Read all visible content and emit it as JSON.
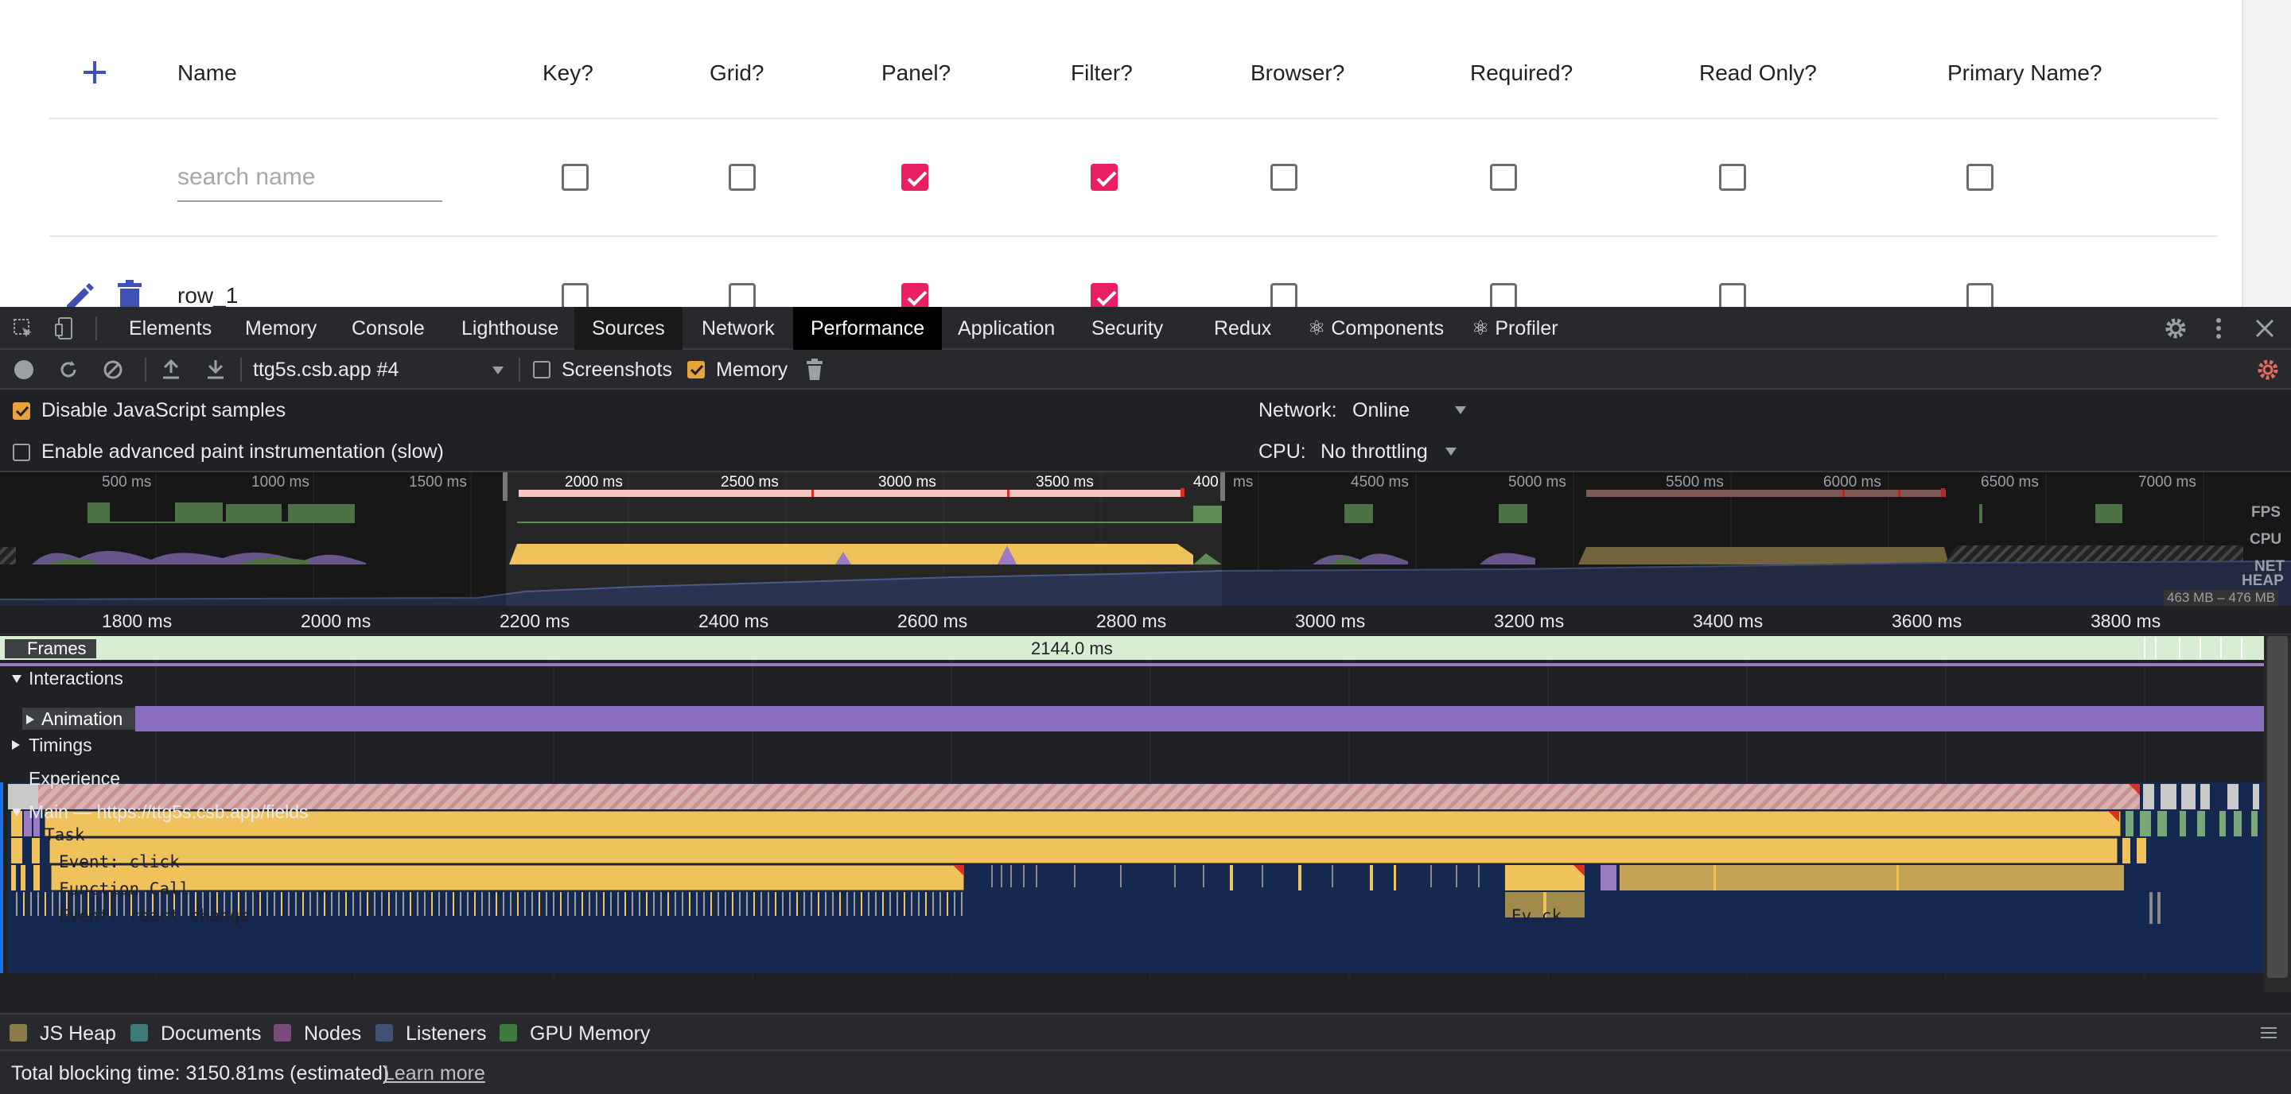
{
  "app": {
    "headers": [
      "Name",
      "Key?",
      "Grid?",
      "Panel?",
      "Filter?",
      "Browser?",
      "Required?",
      "Read Only?",
      "Primary Name?"
    ],
    "search_placeholder": "search name",
    "filter_row": [
      false,
      false,
      true,
      true,
      false,
      false,
      false,
      false
    ],
    "row1_label": "row_1",
    "row1_checks": [
      false,
      false,
      true,
      true,
      false,
      false,
      false,
      false
    ]
  },
  "devtools": {
    "tabs": [
      "Elements",
      "Memory",
      "Console",
      "Lighthouse",
      "Sources",
      "Network",
      "Performance",
      "Application",
      "Security",
      "Redux",
      "⚛ Components",
      "⚛ Profiler"
    ],
    "active_tab": "Performance",
    "toolbar": {
      "profile_select": "ttg5s.csb.app #4",
      "screenshots_label": "Screenshots",
      "screenshots_checked": false,
      "memory_label": "Memory",
      "memory_checked": true
    },
    "settings": {
      "disable_js_samples": "Disable JavaScript samples",
      "disable_js_checked": true,
      "advanced_paint": "Enable advanced paint instrumentation (slow)",
      "advanced_paint_checked": false,
      "network_label": "Network:",
      "network_value": "Online",
      "cpu_label": "CPU:",
      "cpu_value": "No throttling"
    },
    "overview": {
      "ticks": [
        "500 ms",
        "1000 ms",
        "1500 ms",
        "2000 ms",
        "2500 ms",
        "3000 ms",
        "3500 ms",
        "400",
        "ms",
        "4500 ms",
        "5000 ms",
        "5500 ms",
        "6000 ms",
        "6500 ms",
        "7000 ms"
      ],
      "fps_label": "FPS",
      "cpu_label": "CPU",
      "net_label": "NET",
      "heap_label": "HEAP",
      "heap_range": "463 MB – 476 MB"
    },
    "ruler_ticks": [
      "1800 ms",
      "2000 ms",
      "2200 ms",
      "2400 ms",
      "2600 ms",
      "2800 ms",
      "3000 ms",
      "3200 ms",
      "3400 ms",
      "3600 ms",
      "3800 ms"
    ],
    "tracks": {
      "frames_label": "Frames",
      "frames_duration": "2144.0 ms",
      "interactions_label": "Interactions",
      "animation_label": "Animation",
      "timings_label": "Timings",
      "experience_label": "Experience",
      "main_label": "Main — https://ttg5s.csb.app/fields",
      "task_label": "Task",
      "event_click": "Event: click",
      "function_call": "Function Call",
      "event_react_change": "Event: react-change",
      "event_short": "Ev…ck"
    },
    "legend": [
      {
        "label": "JS Heap",
        "color": "#8d7a4a"
      },
      {
        "label": "Documents",
        "color": "#3f7a7a"
      },
      {
        "label": "Nodes",
        "color": "#7a4a7a"
      },
      {
        "label": "Listeners",
        "color": "#3f5275"
      },
      {
        "label": "GPU Memory",
        "color": "#3f7a3f"
      }
    ],
    "footer": {
      "tbt": "Total blocking time: 3150.81ms (estimated)",
      "learn_more": "Learn more"
    }
  }
}
